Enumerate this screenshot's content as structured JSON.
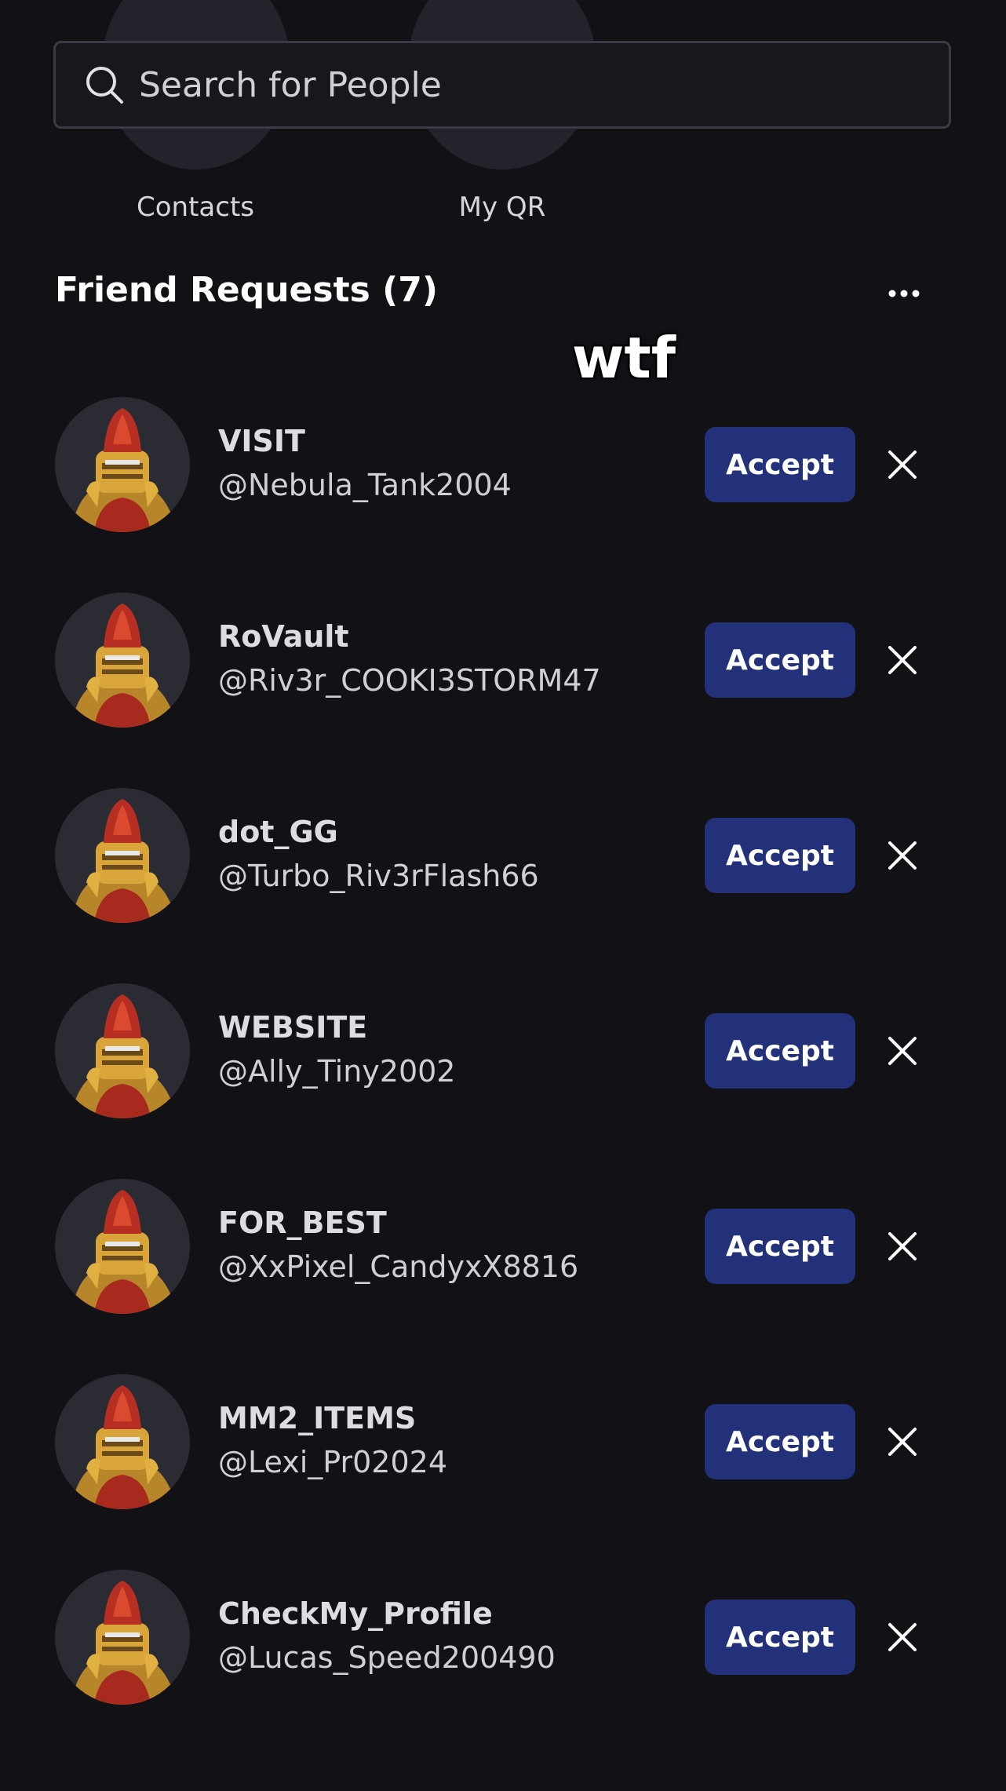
{
  "search": {
    "placeholder": "Search for People"
  },
  "quick_actions": [
    {
      "label": "Contacts"
    },
    {
      "label": "My QR"
    }
  ],
  "friend_requests": {
    "title": "Friend Requests (7)",
    "accept_label": "Accept",
    "items": [
      {
        "display_name": "VISIT",
        "username": "@Nebula_Tank2004"
      },
      {
        "display_name": "RoVault",
        "username": "@Riv3r_COOKI3STORM47"
      },
      {
        "display_name": "dot_GG",
        "username": "@Turbo_Riv3rFlash66"
      },
      {
        "display_name": "WEBSITE",
        "username": "@Ally_Tiny2002"
      },
      {
        "display_name": "FOR_BEST",
        "username": "@XxPixel_CandyxX8816"
      },
      {
        "display_name": "MM2_ITEMS",
        "username": "@Lexi_Pr02024"
      },
      {
        "display_name": "CheckMy_Profile",
        "username": "@Lucas_Speed200490"
      }
    ]
  },
  "overlay": {
    "caption": "wtf"
  },
  "colors": {
    "background": "#111116",
    "accept_button": "#22317a",
    "search_border": "#3a3b44"
  }
}
